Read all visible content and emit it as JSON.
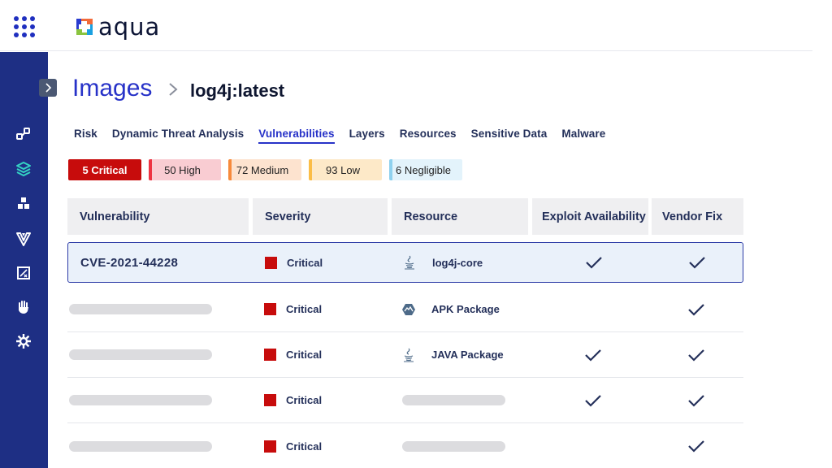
{
  "brand": {
    "name": "aqua"
  },
  "icons": {
    "apps": "apps-grid-icon",
    "collapse": "chevron-right-icon",
    "sidebar": [
      "integrations-icon",
      "images-layers-icon",
      "workloads-cubes-icon",
      "vshield-icon",
      "compliance-icon",
      "hand-icon",
      "settings-gear-icon"
    ]
  },
  "colors": {
    "accent": "#2732c8",
    "sidebar": "#1e2f84",
    "critical": "#c70c0c",
    "high": "#ee3342",
    "medium": "#f78a3b",
    "low": "#fbbd46",
    "negligible": "#8fd1ee"
  },
  "breadcrumb": {
    "title": "Images",
    "current": "log4j:latest"
  },
  "tabs": [
    {
      "label": "Risk",
      "active": false
    },
    {
      "label": "Dynamic Threat Analysis",
      "active": false
    },
    {
      "label": "Vulnerabilities",
      "active": true
    },
    {
      "label": "Layers",
      "active": false
    },
    {
      "label": "Resources",
      "active": false
    },
    {
      "label": "Sensitive Data",
      "active": false
    },
    {
      "label": "Malware",
      "active": false
    }
  ],
  "severity_chips": [
    {
      "label": "5 Critical",
      "level": "critical"
    },
    {
      "label": "50 High",
      "level": "high"
    },
    {
      "label": "72 Medium",
      "level": "medium"
    },
    {
      "label": "93 Low",
      "level": "low"
    },
    {
      "label": "6 Negligible",
      "level": "negligible"
    }
  ],
  "table": {
    "columns": [
      "Vulnerability",
      "Severity",
      "Resource",
      "Exploit Availability",
      "Vendor Fix"
    ],
    "rows": [
      {
        "vulnerability": "CVE-2021-44228",
        "severity": "Critical",
        "resource": "log4j-core",
        "resource_icon": "java-icon",
        "exploit": true,
        "vendor_fix": true
      },
      {
        "vulnerability": "",
        "severity": "Critical",
        "resource": "APK Package",
        "resource_icon": "alpine-icon",
        "exploit": false,
        "vendor_fix": true
      },
      {
        "vulnerability": "",
        "severity": "Critical",
        "resource": "JAVA Package",
        "resource_icon": "java-icon",
        "exploit": true,
        "vendor_fix": true
      },
      {
        "vulnerability": "",
        "severity": "Critical",
        "resource": "",
        "resource_icon": "",
        "exploit": true,
        "vendor_fix": true
      },
      {
        "vulnerability": "",
        "severity": "Critical",
        "resource": "",
        "resource_icon": "",
        "exploit": false,
        "vendor_fix": true
      }
    ]
  }
}
